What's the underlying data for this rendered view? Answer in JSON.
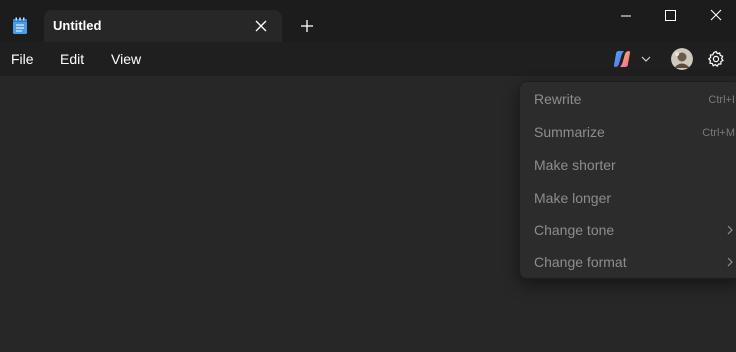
{
  "tab": {
    "title": "Untitled"
  },
  "menubar": {
    "items": [
      {
        "label": "File"
      },
      {
        "label": "Edit"
      },
      {
        "label": "View"
      }
    ]
  },
  "dropdown": {
    "items": [
      {
        "label": "Rewrite",
        "shortcut": "Ctrl+I",
        "submenu": false,
        "enabled": false
      },
      {
        "label": "Summarize",
        "shortcut": "Ctrl+M",
        "submenu": false,
        "enabled": false
      },
      {
        "label": "Make shorter",
        "shortcut": "",
        "submenu": false,
        "enabled": false
      },
      {
        "label": "Make longer",
        "shortcut": "",
        "submenu": false,
        "enabled": false
      },
      {
        "label": "Change tone",
        "shortcut": "",
        "submenu": true,
        "enabled": false
      },
      {
        "label": "Change format",
        "shortcut": "",
        "submenu": true,
        "enabled": false
      }
    ]
  },
  "icons": {
    "app": "notepad-icon",
    "tab_close": "close-icon",
    "new_tab": "plus-icon",
    "minimize": "minimize-icon",
    "maximize": "maximize-icon",
    "close": "close-icon",
    "copilot": "copilot-icon",
    "avatar": "avatar",
    "settings": "gear-icon",
    "submenu": "chevron-right-icon"
  },
  "colors": {
    "titlebar_bg": "#1c1c1c",
    "menubar_bg": "#1f1f1f",
    "editor_bg": "#272727",
    "dropdown_bg": "#2c2c2c",
    "disabled_text": "#8d8d8d"
  }
}
